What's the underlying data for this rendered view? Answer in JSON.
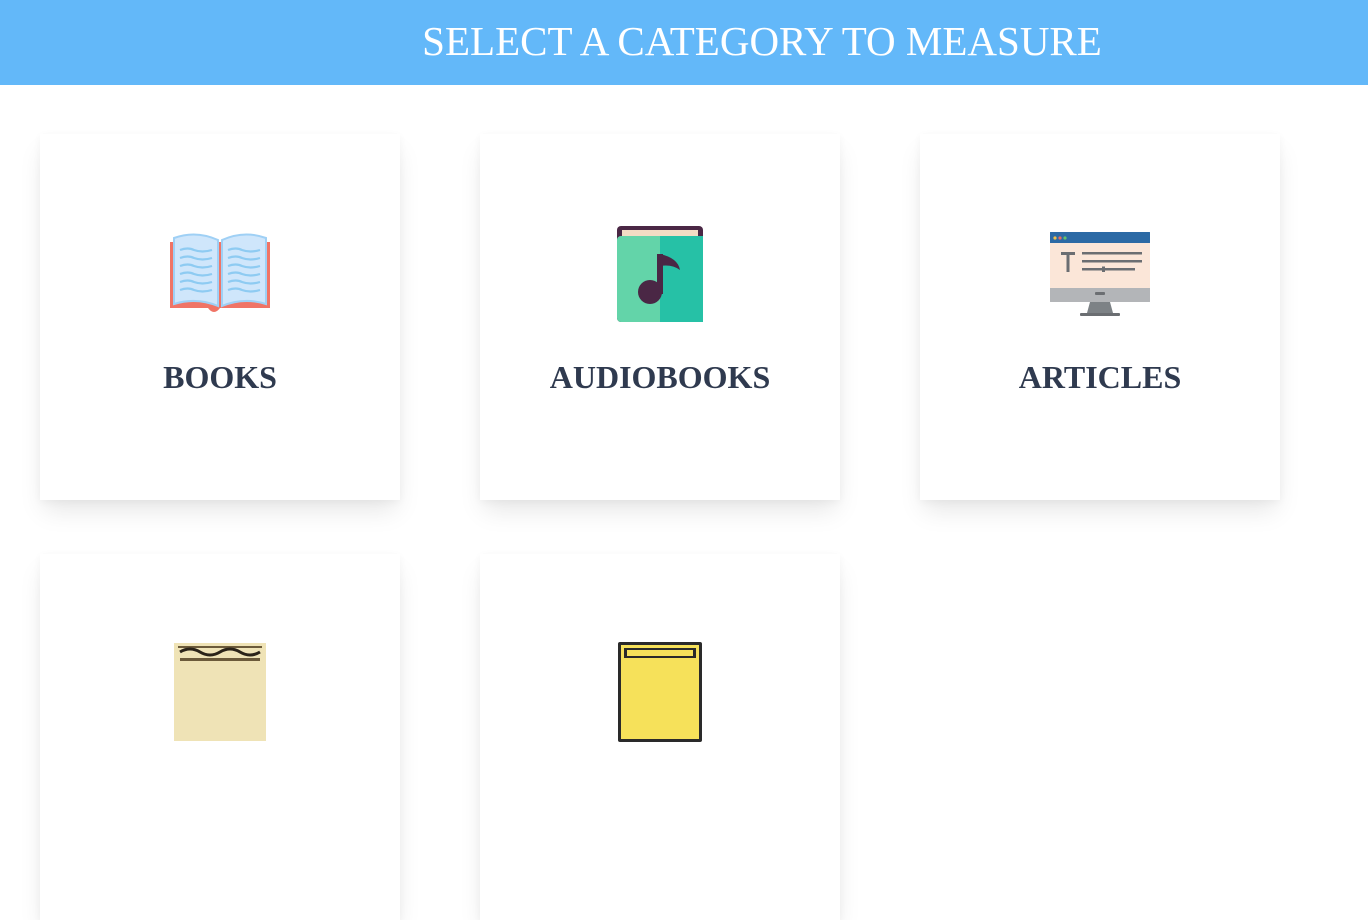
{
  "header": {
    "title": "SELECT A CATEGORY TO MEASURE"
  },
  "categories": [
    {
      "label": "BOOKS",
      "icon": "open-book-icon"
    },
    {
      "label": "AUDIOBOOKS",
      "icon": "music-book-icon"
    },
    {
      "label": "ARTICLES",
      "icon": "monitor-text-icon"
    },
    {
      "label": "",
      "icon": "newspaper-icon"
    },
    {
      "label": "",
      "icon": "comics-icon"
    }
  ],
  "colors": {
    "header_bg": "#63b8f9",
    "header_text": "#ffffff",
    "label_text": "#2f3a4f"
  }
}
